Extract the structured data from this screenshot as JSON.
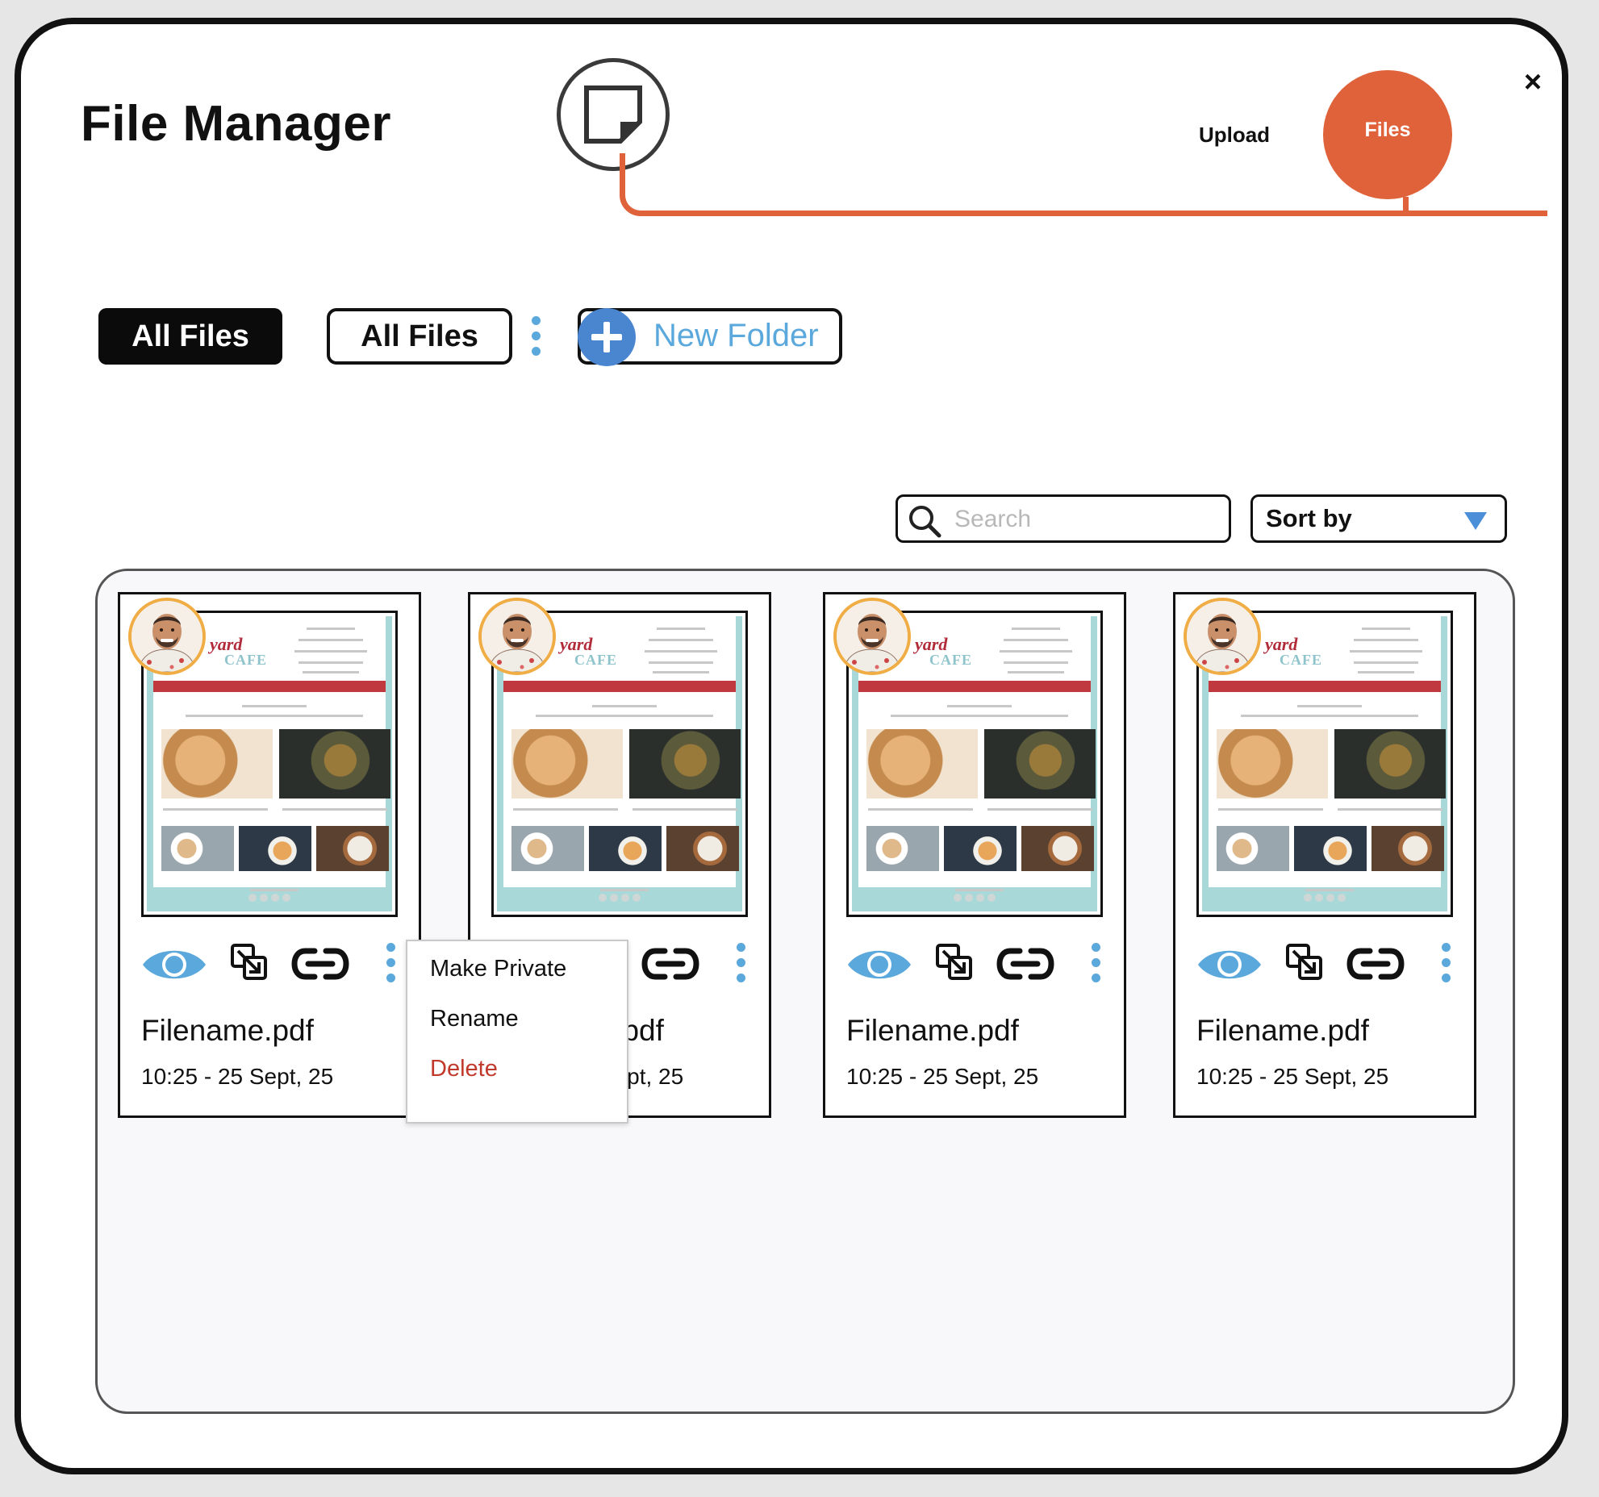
{
  "header": {
    "title": "File Manager",
    "tabs": [
      {
        "label": "Upload",
        "active": false
      },
      {
        "label": "Files",
        "active": true
      }
    ],
    "close_label": "×",
    "accent_color": "#e0623a"
  },
  "toolbar": {
    "filter_primary": "All Files",
    "filter_secondary": "All Files",
    "new_folder_label": "New Folder",
    "new_folder_icon": "plus-icon"
  },
  "controls": {
    "search_placeholder": "Search",
    "sort_label": "Sort by"
  },
  "files": [
    {
      "filename": "Filename.pdf",
      "date": "10:25 - 25 Sept, 25"
    },
    {
      "filename": "Filename.pdf",
      "date": "10:25 - 25 Sept, 25"
    },
    {
      "filename": "Filename.pdf",
      "date": "10:25 - 25 Sept, 25"
    },
    {
      "filename": "Filename.pdf",
      "date": "10:25 - 25 Sept, 25"
    }
  ],
  "thumbnail": {
    "logo_line1": "yard",
    "logo_line2": "CAFE"
  },
  "context_menu": {
    "items": [
      {
        "label": "Make Private"
      },
      {
        "label": "Rename"
      },
      {
        "label": "Delete",
        "danger": true
      }
    ]
  },
  "icons": {
    "preview": "eye-icon",
    "move": "move-icon",
    "link": "link-icon",
    "more": "more-vertical-icon"
  }
}
